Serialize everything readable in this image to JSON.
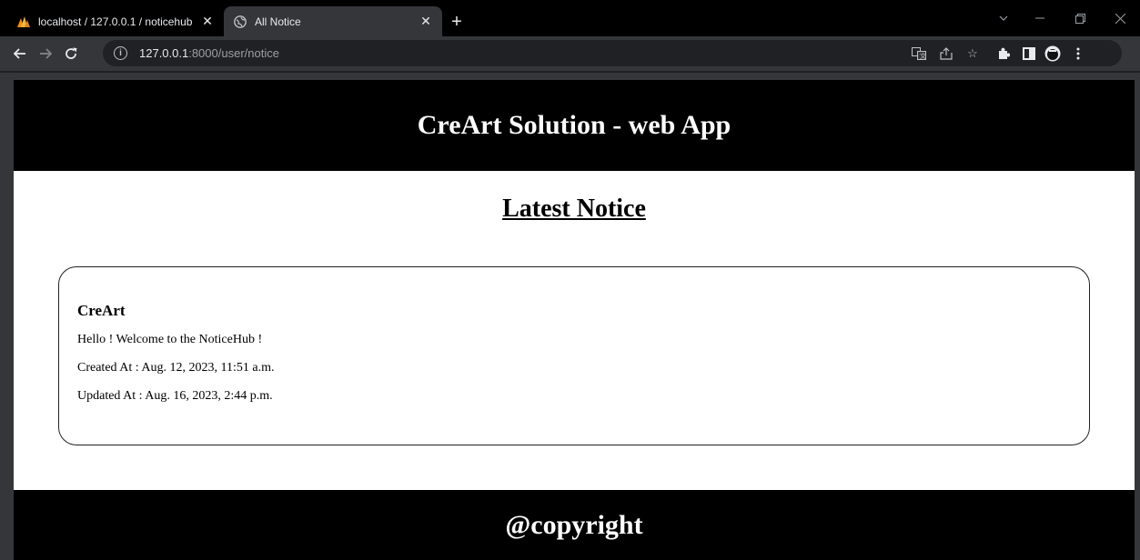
{
  "browser": {
    "tabs": [
      {
        "title": "localhost / 127.0.0.1 / noticehub",
        "active": false
      },
      {
        "title": "All Notice",
        "active": true
      }
    ],
    "address": {
      "host": "127.0.0.1",
      "path": ":8000/user/notice"
    }
  },
  "page": {
    "header_title": "CreArt Solution - web App",
    "heading": "Latest Notice",
    "notices": [
      {
        "author": "CreArt",
        "message": "Hello ! Welcome to the NoticeHub !",
        "created": "Created At : Aug. 12, 2023, 11:51 a.m.",
        "updated": "Updated At : Aug. 16, 2023, 2:44 p.m."
      }
    ],
    "footer_text": "@copyright"
  },
  "colors": {
    "header_bg": "#000000",
    "page_bg": "#ffffff",
    "chrome_bg": "#35363a"
  }
}
